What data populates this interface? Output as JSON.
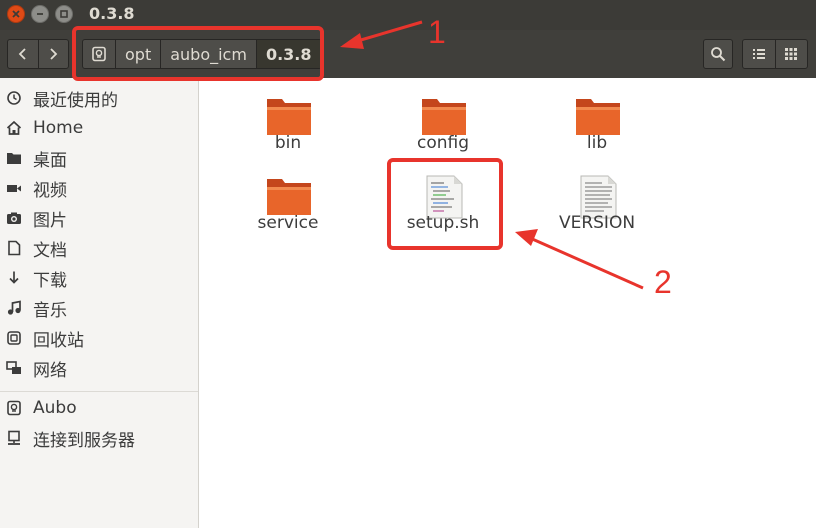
{
  "window": {
    "title": "0.3.8"
  },
  "path": {
    "segments": [
      "opt",
      "aubo_icm",
      "0.3.8"
    ]
  },
  "sidebar": {
    "items": [
      {
        "label": "最近使用的",
        "icon": "clock-icon"
      },
      {
        "label": "Home",
        "icon": "home-icon"
      },
      {
        "label": "桌面",
        "icon": "folder-icon"
      },
      {
        "label": "视频",
        "icon": "video-icon"
      },
      {
        "label": "图片",
        "icon": "camera-icon"
      },
      {
        "label": "文档",
        "icon": "document-icon"
      },
      {
        "label": "下载",
        "icon": "download-icon"
      },
      {
        "label": "音乐",
        "icon": "music-icon"
      },
      {
        "label": "回收站",
        "icon": "trash-icon"
      },
      {
        "label": "网络",
        "icon": "network-icon"
      },
      {
        "label": "Aubo",
        "icon": "drive-icon"
      },
      {
        "label": "连接到服务器",
        "icon": "server-icon"
      }
    ]
  },
  "files": [
    {
      "name": "bin",
      "type": "folder"
    },
    {
      "name": "config",
      "type": "folder"
    },
    {
      "name": "lib",
      "type": "folder"
    },
    {
      "name": "service",
      "type": "folder"
    },
    {
      "name": "setup.sh",
      "type": "script"
    },
    {
      "name": "VERSION",
      "type": "text"
    }
  ],
  "annotations": {
    "label_1": "1",
    "label_2": "2",
    "color": "#e8342c"
  },
  "colors": {
    "folder_orange": "#e8652a",
    "titlebar": "#3c3b37",
    "close_button": "#df4a16"
  }
}
